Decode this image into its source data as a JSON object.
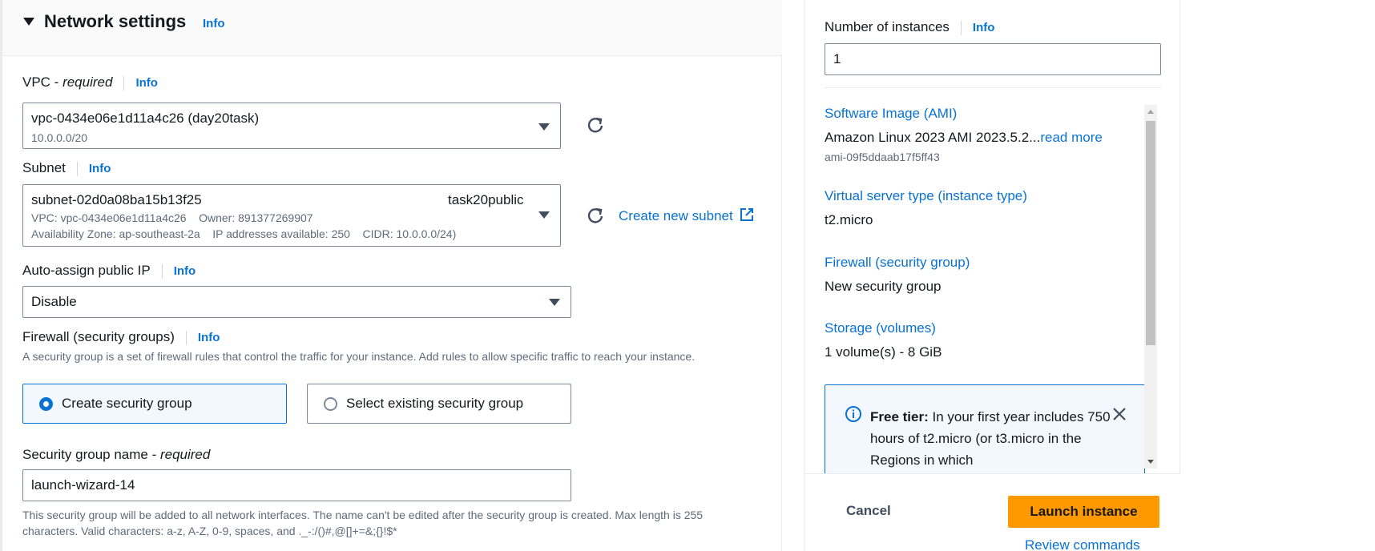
{
  "network": {
    "title": "Network settings",
    "info": "Info",
    "vpc": {
      "label_main": "VPC - ",
      "label_req": "required",
      "info": "Info",
      "value": "vpc-0434e06e1d11a4c26 (day20task)",
      "cidr": "10.0.0.0/20"
    },
    "subnet": {
      "label": "Subnet",
      "info": "Info",
      "id": "subnet-02d0a08ba15b13f25",
      "name": "task20public",
      "line2": "VPC: vpc-0434e06e1d11a4c26    Owner: 891377269907",
      "line3": "Availability Zone: ap-southeast-2a    IP addresses available: 250    CIDR: 10.0.0.0/24)",
      "create_link": "Create new subnet"
    },
    "auto_ip": {
      "label": "Auto-assign public IP",
      "info": "Info",
      "value": "Disable"
    },
    "firewall": {
      "label": "Firewall (security groups)",
      "info": "Info",
      "description": "A security group is a set of firewall rules that control the traffic for your instance. Add rules to allow specific traffic to reach your instance.",
      "option_create": "Create security group",
      "option_existing": "Select existing security group"
    },
    "sg_name": {
      "label_main": "Security group name - ",
      "label_req": "required",
      "value": "launch-wizard-14",
      "help": "This security group will be added to all network interfaces. The name can't be edited after the security group is created. Max length is 255 characters. Valid characters: a-z, A-Z, 0-9, spaces, and ._-:/()#,@[]+=&;{}!$*"
    }
  },
  "summary": {
    "instances_label": "Number of instances",
    "instances_info": "Info",
    "instances_value": "1",
    "ami_link": "Software Image (AMI)",
    "ami_value": "Amazon Linux 2023 AMI 2023.5.2...",
    "ami_readmore": "read more",
    "ami_id": "ami-09f5ddaab17f5ff43",
    "type_link": "Virtual server type (instance type)",
    "type_value": "t2.micro",
    "firewall_link": "Firewall (security group)",
    "firewall_value": "New security group",
    "storage_link": "Storage (volumes)",
    "storage_value": "1 volume(s) - 8 GiB",
    "free_tier_bold": "Free tier:",
    "free_tier_text": " In your first year includes 750 hours of t2.micro (or t3.micro in the Regions in which"
  },
  "footer": {
    "cancel": "Cancel",
    "launch": "Launch instance",
    "review": "Review commands"
  },
  "colors": {
    "accent": "#0972d3",
    "launch_button": "#ff9900"
  }
}
